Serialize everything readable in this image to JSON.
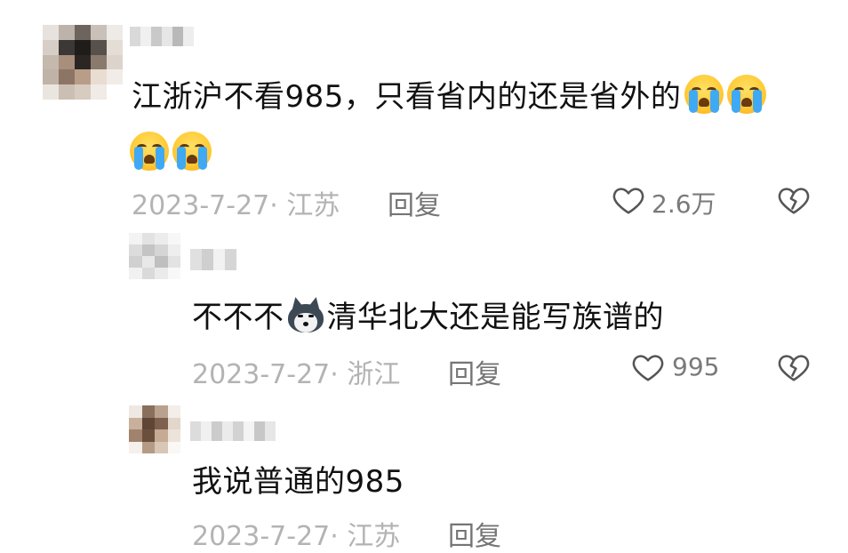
{
  "comments": [
    {
      "text": "江浙沪不看985，只看省内的还是省外的",
      "trailing_emoji": [
        "crying-face",
        "crying-face",
        "crying-face",
        "crying-face"
      ],
      "date_location": "2023-7-27· 江苏",
      "reply_label": "回复",
      "likes": "2.6万"
    }
  ],
  "replies": [
    {
      "text_before_emoji": "不不不",
      "emoji": "husky-dog-face",
      "text_after_emoji": "清华北大还是能写族谱的",
      "date_location": "2023-7-27· 浙江",
      "reply_label": "回复",
      "likes": "995"
    },
    {
      "text": "我说普通的985",
      "date_location": "2023-7-27· 江苏",
      "reply_label": "回复"
    }
  ],
  "icons": {
    "like": "heart-outline-icon",
    "dislike": "broken-heart-icon"
  },
  "colors": {
    "text_primary": "#111111",
    "meta_gray": "#b3b3b3",
    "reply_gray": "#757575",
    "icon_gray": "#555555"
  }
}
